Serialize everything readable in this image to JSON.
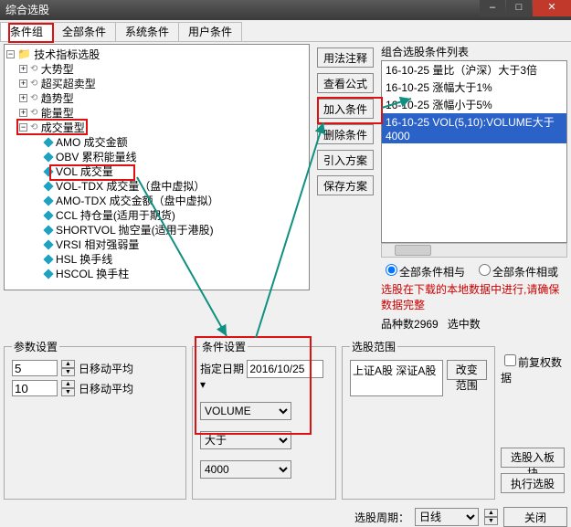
{
  "window": {
    "title": "综合选股"
  },
  "tabs": [
    "条件组",
    "全部条件",
    "系统条件",
    "用户条件"
  ],
  "tree": {
    "root": "技术指标选股",
    "groups": [
      "大势型",
      "超买超卖型",
      "趋势型",
      "能量型",
      "成交量型"
    ],
    "vol_items": [
      "AMO 成交金额",
      "OBV 累积能量线",
      "VOL 成交量",
      "VOL-TDX 成交量（盘中虚拟）",
      "AMO-TDX 成交金额（盘中虚拟）",
      "CCL 持仓量(适用于期货)",
      "SHORTVOL 抛空量(适用于港股)",
      "VRSI 相对强弱量",
      "HSL 换手线",
      "HSCOL 换手柱"
    ]
  },
  "action_buttons": {
    "usage": "用法注释",
    "view_formula": "查看公式",
    "add": "加入条件",
    "delete": "删除条件",
    "import": "引入方案",
    "save": "保存方案"
  },
  "cond_list": {
    "title": "组合选股条件列表",
    "items": [
      "16-10-25 量比（沪深）大于3倍",
      "16-10-25 涨幅大于1%",
      "16-10-25 涨幅小于5%",
      "16-10-25 VOL(5,10):VOLUME大于4000"
    ],
    "selected_index": 3
  },
  "radios": {
    "and": "全部条件相与",
    "or": "全部条件相或"
  },
  "warning": "选股在下载的本地数据中进行,请确保数据完整",
  "counts": {
    "variety_label": "品种数",
    "variety": "2969",
    "selected_label": "选中数"
  },
  "param": {
    "legend": "参数设置",
    "ma_label": "日移动平均",
    "ma1": "5",
    "ma2": "10"
  },
  "cond_set": {
    "legend": "条件设置",
    "date_label": "指定日期",
    "date": "2016/10/25",
    "field": "VOLUME",
    "op": "大于",
    "value": "4000"
  },
  "scope": {
    "legend": "选股范围",
    "text": "上证A股 深证A股",
    "change": "改变范围"
  },
  "qfq": "前复权数据",
  "side_btns": {
    "to_block": "选股入板块",
    "run": "执行选股"
  },
  "bottom": {
    "period_label": "选股周期：",
    "period": "日线",
    "close": "关闭"
  }
}
